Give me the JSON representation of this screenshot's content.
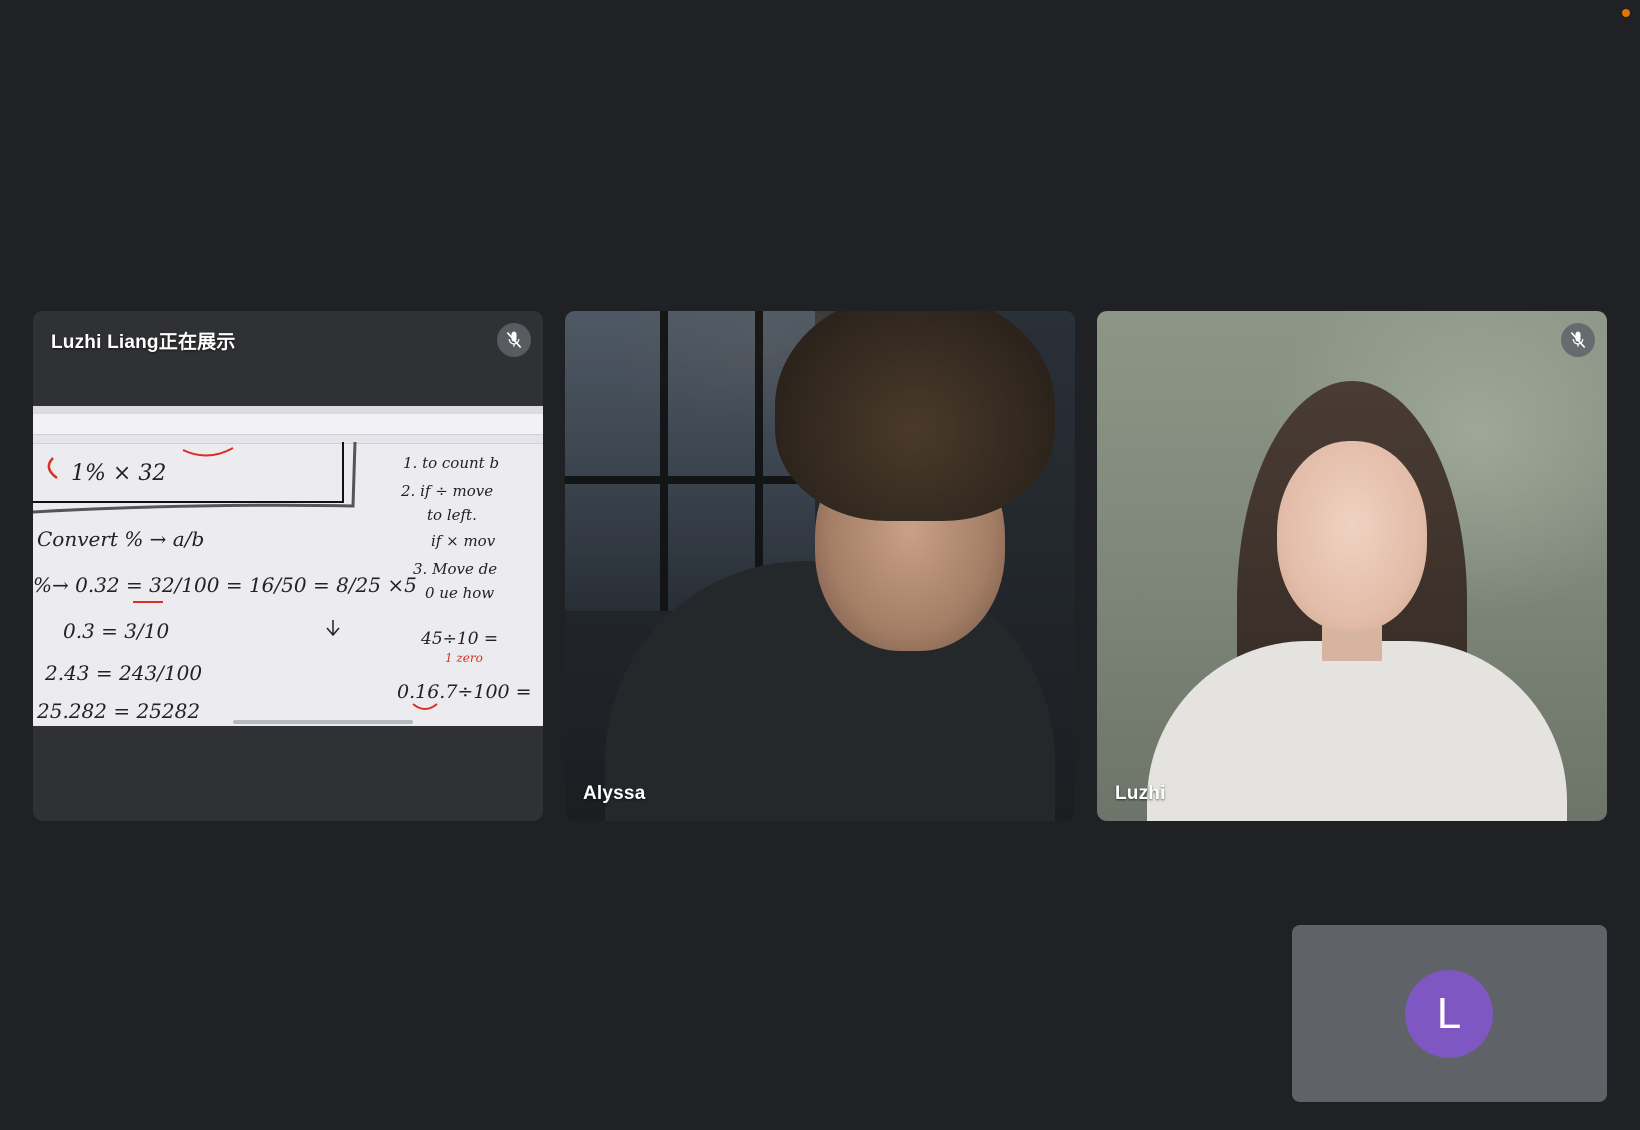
{
  "presentation_tile": {
    "label": "Luzhi Liang正在展示",
    "muted_icon": "mic-off-icon"
  },
  "participants": [
    {
      "name": "Alyssa",
      "muted": false
    },
    {
      "name": "Luzhi",
      "muted": true,
      "muted_icon": "mic-off-icon"
    }
  ],
  "shared_screen": {
    "top_left": "1% × 32",
    "steps": [
      "1. to count b",
      "2. if ÷ move",
      "to left.",
      "if × mov",
      "3. Move de",
      "0 ue how"
    ],
    "heading": "Convert % → a/b",
    "line1": "%→ 0.32 = 32/100 = 16/50 = 8/25 ×5",
    "line2": "0.3 = 3/10",
    "line3": "2.43 = 243/100",
    "line4": "25.282 = 25282",
    "right1": "45÷10 =",
    "right1_note": "1 zero",
    "right2": "0.16.7÷100 ="
  },
  "self_view": {
    "avatar_letter": "L",
    "avatar_color": "#7e57c2"
  },
  "colors": {
    "background": "#202124",
    "status_dot": "#e37400"
  }
}
